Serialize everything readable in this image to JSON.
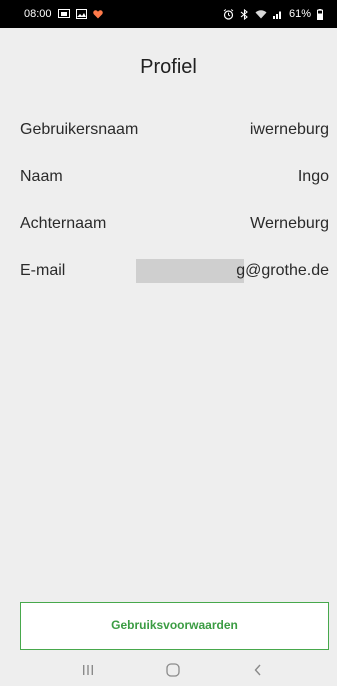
{
  "status_bar": {
    "time": "08:00",
    "battery": "61%",
    "icons": [
      "screen-cast-icon",
      "gallery-icon",
      "heart-icon",
      "alarm-icon",
      "bluetooth-icon",
      "wifi-icon",
      "signal-icon",
      "battery-icon"
    ]
  },
  "header": {
    "title": "Profiel"
  },
  "profile": {
    "rows": [
      {
        "label": "Gebruikersnaam",
        "value": "iwerneburg"
      },
      {
        "label": "Naam",
        "value": "Ingo"
      },
      {
        "label": "Achternaam",
        "value": "Werneburg"
      },
      {
        "label": "E-mail",
        "value": "g@grothe.de"
      }
    ]
  },
  "footer": {
    "terms_label": "Gebruiksvoorwaarden"
  },
  "colors": {
    "background": "#eeeeee",
    "accent": "#3b9c43",
    "status_bar": "#000000"
  },
  "nav": {
    "icons": [
      "recent-apps-icon",
      "home-icon",
      "back-icon"
    ]
  }
}
